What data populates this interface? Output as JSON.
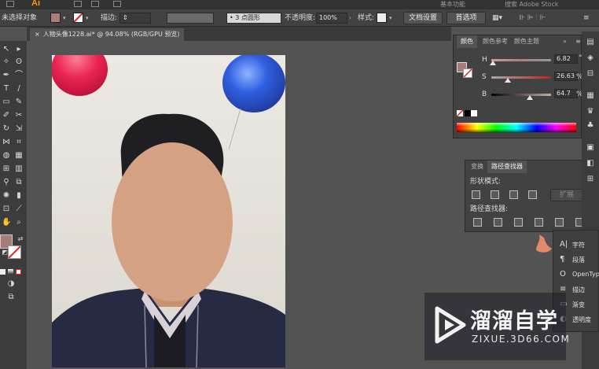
{
  "app": {
    "logo": "Ai",
    "topstrip_label": "基本功能",
    "stock_search_placeholder": "搜索 Adobe Stock"
  },
  "control_bar": {
    "selection_label": "未选择对象",
    "fill_color": "#b07a78",
    "stroke_label": "描边:",
    "stroke_style": "3 点圆形",
    "opacity_label": "不透明度:",
    "opacity_value": "100%",
    "style_label": "样式:",
    "doc_setup_button": "文档设置",
    "prefs_button": "首选项"
  },
  "document_tab": {
    "title": "人物头像1228.ai* @ 94.08% (RGB/GPU 预览)",
    "close": "×"
  },
  "color_panel": {
    "tabs": [
      "颜色",
      "颜色参考",
      "颜色主题"
    ],
    "channels": [
      {
        "label": "H",
        "value": "6.82",
        "unit": "°",
        "position": 0.02
      },
      {
        "label": "S",
        "value": "26.63",
        "unit": "%",
        "position": 0.27
      },
      {
        "label": "B",
        "value": "64.7",
        "unit": "%",
        "position": 0.65
      }
    ],
    "swatch_color": "#a77b78"
  },
  "pathfinder_panel": {
    "tabs": [
      "变换",
      "路径查找器"
    ],
    "shape_modes_label": "形状模式:",
    "expand_button": "扩展",
    "pathfinders_label": "路径查找器:"
  },
  "dock_menu": {
    "items": [
      {
        "icon": "A|",
        "label": "字符"
      },
      {
        "icon": "¶",
        "label": "段落"
      },
      {
        "icon": "O",
        "label": "OpenType"
      },
      {
        "icon": "≡",
        "label": "描边"
      },
      {
        "icon": "▭",
        "label": "渐变"
      },
      {
        "icon": "◐",
        "label": "透明度"
      }
    ]
  },
  "watermark": {
    "brand": "溜溜自学",
    "url": "ZIXUE.3D66.COM"
  },
  "colors": {
    "face": "#d4a183",
    "balloon_red": "#ea2450",
    "balloon_blue": "#2f5fe0",
    "jacket": "#262a42"
  }
}
